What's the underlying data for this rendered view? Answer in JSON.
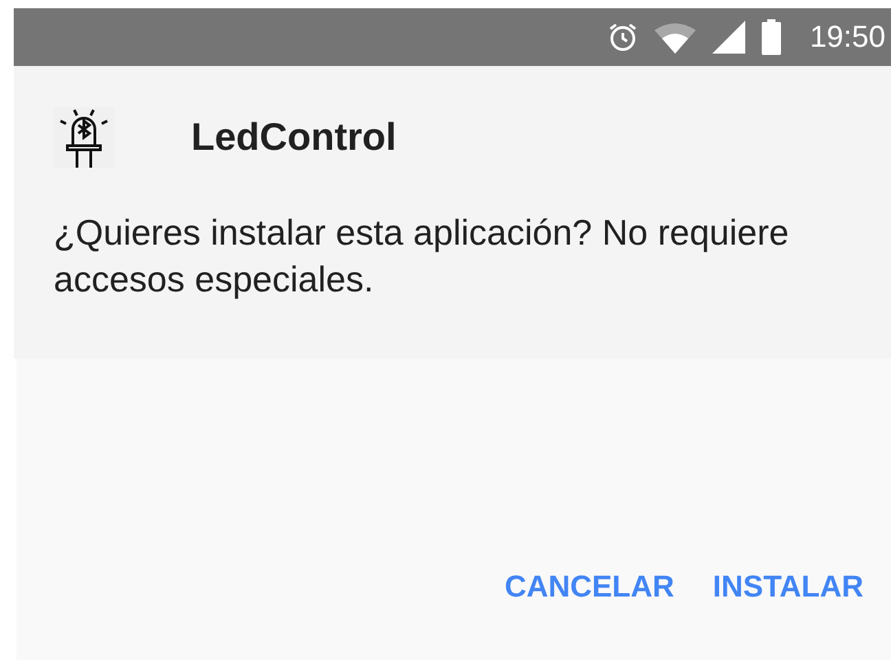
{
  "status_bar": {
    "time": "19:50"
  },
  "app": {
    "name": "LedControl"
  },
  "message": "¿Quieres instalar esta aplicación? No requiere accesos especiales.",
  "buttons": [
    {
      "label": "CANCELAR"
    },
    {
      "label": "INSTALAR"
    }
  ]
}
